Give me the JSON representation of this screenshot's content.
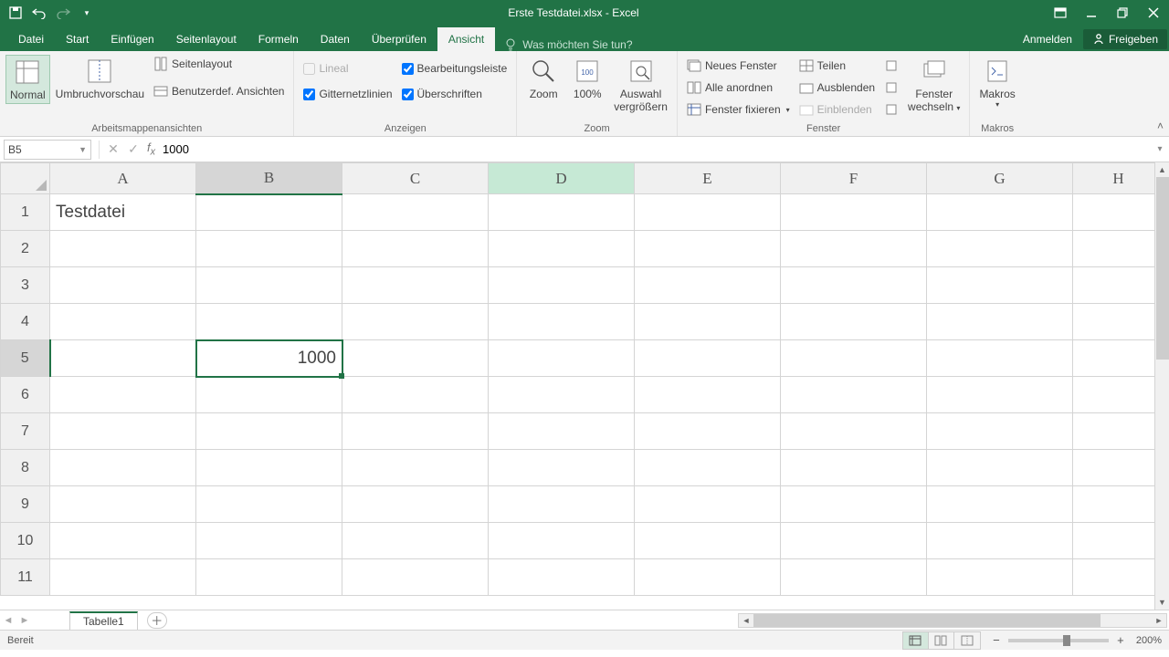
{
  "titlebar": {
    "title": "Erste Testdatei.xlsx - Excel"
  },
  "qat": {
    "save": "",
    "undo": "",
    "redo": ""
  },
  "tabs": {
    "file": "Datei",
    "home": "Start",
    "insert": "Einfügen",
    "pagelayout": "Seitenlayout",
    "formulas": "Formeln",
    "data": "Daten",
    "review": "Überprüfen",
    "view": "Ansicht",
    "tellme_placeholder": "Was möchten Sie tun?",
    "signin": "Anmelden",
    "share": "Freigeben"
  },
  "ribbon": {
    "views": {
      "normal": "Normal",
      "pagebreak": "Umbruchvorschau",
      "pagelayout": "Seitenlayout",
      "custom": "Benutzerdef. Ansichten",
      "label": "Arbeitsmappenansichten"
    },
    "show": {
      "ruler": "Lineal",
      "formula_bar": "Bearbeitungsleiste",
      "gridlines": "Gitternetzlinien",
      "headings": "Überschriften",
      "ruler_checked": false,
      "formula_bar_checked": true,
      "gridlines_checked": true,
      "headings_checked": true,
      "label": "Anzeigen"
    },
    "zoom": {
      "zoom": "Zoom",
      "hundred": "100%",
      "selection_l1": "Auswahl",
      "selection_l2": "vergrößern",
      "label": "Zoom"
    },
    "window": {
      "new": "Neues Fenster",
      "arrange": "Alle anordnen",
      "freeze": "Fenster fixieren",
      "split": "Teilen",
      "hide": "Ausblenden",
      "unhide": "Einblenden",
      "switch_l1": "Fenster",
      "switch_l2": "wechseln",
      "label": "Fenster"
    },
    "macros": {
      "macros": "Makros",
      "label": "Makros"
    }
  },
  "formula_bar": {
    "name_box": "B5",
    "formula": "1000"
  },
  "columns": [
    "A",
    "B",
    "C",
    "D",
    "E",
    "F",
    "G",
    "H"
  ],
  "rows": [
    "1",
    "2",
    "3",
    "4",
    "5",
    "6",
    "7",
    "8",
    "9",
    "10",
    "11"
  ],
  "cells": {
    "A1": "Testdatei",
    "B5": "1000"
  },
  "selected_cell": "B5",
  "hover_col": "D",
  "sheet": {
    "tab1": "Tabelle1"
  },
  "status": {
    "ready": "Bereit",
    "zoom": "200%"
  }
}
